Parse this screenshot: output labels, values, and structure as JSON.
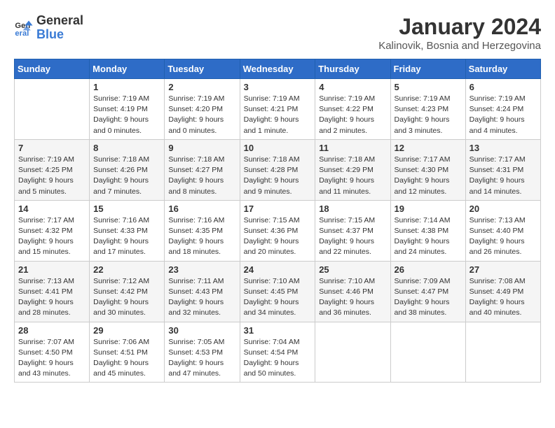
{
  "header": {
    "logo_general": "General",
    "logo_blue": "Blue",
    "month_title": "January 2024",
    "location": "Kalinovik, Bosnia and Herzegovina"
  },
  "weekdays": [
    "Sunday",
    "Monday",
    "Tuesday",
    "Wednesday",
    "Thursday",
    "Friday",
    "Saturday"
  ],
  "weeks": [
    [
      {
        "day": "",
        "info": ""
      },
      {
        "day": "1",
        "info": "Sunrise: 7:19 AM\nSunset: 4:19 PM\nDaylight: 9 hours\nand 0 minutes."
      },
      {
        "day": "2",
        "info": "Sunrise: 7:19 AM\nSunset: 4:20 PM\nDaylight: 9 hours\nand 0 minutes."
      },
      {
        "day": "3",
        "info": "Sunrise: 7:19 AM\nSunset: 4:21 PM\nDaylight: 9 hours\nand 1 minute."
      },
      {
        "day": "4",
        "info": "Sunrise: 7:19 AM\nSunset: 4:22 PM\nDaylight: 9 hours\nand 2 minutes."
      },
      {
        "day": "5",
        "info": "Sunrise: 7:19 AM\nSunset: 4:23 PM\nDaylight: 9 hours\nand 3 minutes."
      },
      {
        "day": "6",
        "info": "Sunrise: 7:19 AM\nSunset: 4:24 PM\nDaylight: 9 hours\nand 4 minutes."
      }
    ],
    [
      {
        "day": "7",
        "info": "Sunrise: 7:19 AM\nSunset: 4:25 PM\nDaylight: 9 hours\nand 5 minutes."
      },
      {
        "day": "8",
        "info": "Sunrise: 7:18 AM\nSunset: 4:26 PM\nDaylight: 9 hours\nand 7 minutes."
      },
      {
        "day": "9",
        "info": "Sunrise: 7:18 AM\nSunset: 4:27 PM\nDaylight: 9 hours\nand 8 minutes."
      },
      {
        "day": "10",
        "info": "Sunrise: 7:18 AM\nSunset: 4:28 PM\nDaylight: 9 hours\nand 9 minutes."
      },
      {
        "day": "11",
        "info": "Sunrise: 7:18 AM\nSunset: 4:29 PM\nDaylight: 9 hours\nand 11 minutes."
      },
      {
        "day": "12",
        "info": "Sunrise: 7:17 AM\nSunset: 4:30 PM\nDaylight: 9 hours\nand 12 minutes."
      },
      {
        "day": "13",
        "info": "Sunrise: 7:17 AM\nSunset: 4:31 PM\nDaylight: 9 hours\nand 14 minutes."
      }
    ],
    [
      {
        "day": "14",
        "info": "Sunrise: 7:17 AM\nSunset: 4:32 PM\nDaylight: 9 hours\nand 15 minutes."
      },
      {
        "day": "15",
        "info": "Sunrise: 7:16 AM\nSunset: 4:33 PM\nDaylight: 9 hours\nand 17 minutes."
      },
      {
        "day": "16",
        "info": "Sunrise: 7:16 AM\nSunset: 4:35 PM\nDaylight: 9 hours\nand 18 minutes."
      },
      {
        "day": "17",
        "info": "Sunrise: 7:15 AM\nSunset: 4:36 PM\nDaylight: 9 hours\nand 20 minutes."
      },
      {
        "day": "18",
        "info": "Sunrise: 7:15 AM\nSunset: 4:37 PM\nDaylight: 9 hours\nand 22 minutes."
      },
      {
        "day": "19",
        "info": "Sunrise: 7:14 AM\nSunset: 4:38 PM\nDaylight: 9 hours\nand 24 minutes."
      },
      {
        "day": "20",
        "info": "Sunrise: 7:13 AM\nSunset: 4:40 PM\nDaylight: 9 hours\nand 26 minutes."
      }
    ],
    [
      {
        "day": "21",
        "info": "Sunrise: 7:13 AM\nSunset: 4:41 PM\nDaylight: 9 hours\nand 28 minutes."
      },
      {
        "day": "22",
        "info": "Sunrise: 7:12 AM\nSunset: 4:42 PM\nDaylight: 9 hours\nand 30 minutes."
      },
      {
        "day": "23",
        "info": "Sunrise: 7:11 AM\nSunset: 4:43 PM\nDaylight: 9 hours\nand 32 minutes."
      },
      {
        "day": "24",
        "info": "Sunrise: 7:10 AM\nSunset: 4:45 PM\nDaylight: 9 hours\nand 34 minutes."
      },
      {
        "day": "25",
        "info": "Sunrise: 7:10 AM\nSunset: 4:46 PM\nDaylight: 9 hours\nand 36 minutes."
      },
      {
        "day": "26",
        "info": "Sunrise: 7:09 AM\nSunset: 4:47 PM\nDaylight: 9 hours\nand 38 minutes."
      },
      {
        "day": "27",
        "info": "Sunrise: 7:08 AM\nSunset: 4:49 PM\nDaylight: 9 hours\nand 40 minutes."
      }
    ],
    [
      {
        "day": "28",
        "info": "Sunrise: 7:07 AM\nSunset: 4:50 PM\nDaylight: 9 hours\nand 43 minutes."
      },
      {
        "day": "29",
        "info": "Sunrise: 7:06 AM\nSunset: 4:51 PM\nDaylight: 9 hours\nand 45 minutes."
      },
      {
        "day": "30",
        "info": "Sunrise: 7:05 AM\nSunset: 4:53 PM\nDaylight: 9 hours\nand 47 minutes."
      },
      {
        "day": "31",
        "info": "Sunrise: 7:04 AM\nSunset: 4:54 PM\nDaylight: 9 hours\nand 50 minutes."
      },
      {
        "day": "",
        "info": ""
      },
      {
        "day": "",
        "info": ""
      },
      {
        "day": "",
        "info": ""
      }
    ]
  ]
}
